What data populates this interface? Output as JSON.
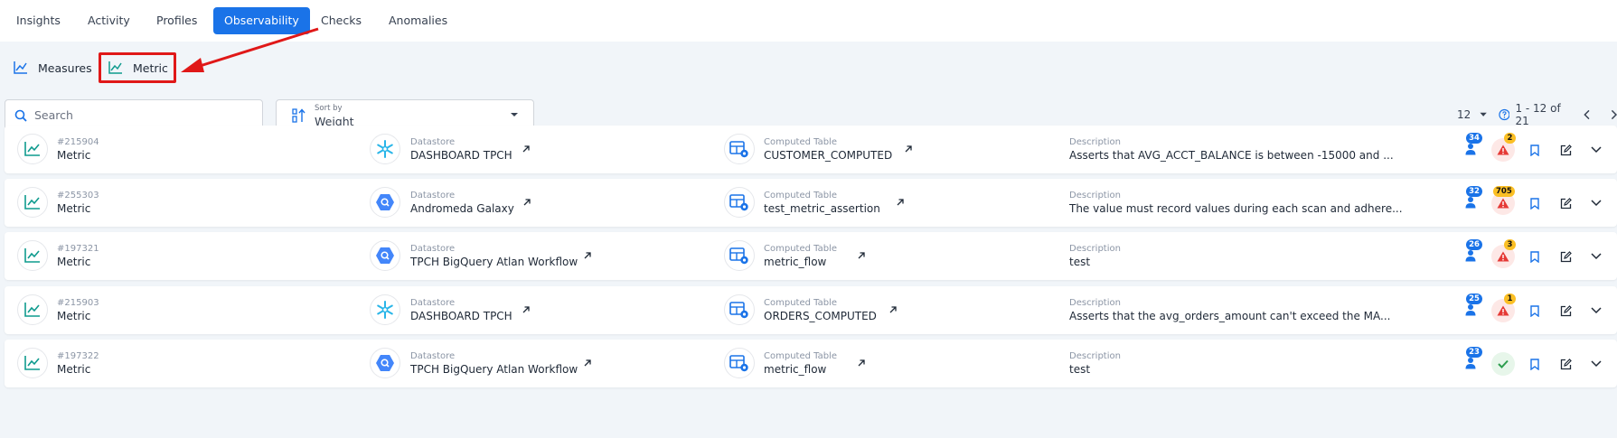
{
  "tabs": [
    {
      "label": "Insights",
      "active": false
    },
    {
      "label": "Activity",
      "active": false
    },
    {
      "label": "Profiles",
      "active": false
    },
    {
      "label": "Observability",
      "active": true
    },
    {
      "label": "Checks",
      "active": false
    },
    {
      "label": "Anomalies",
      "active": false
    }
  ],
  "subtabs": {
    "measures": "Measures",
    "metric": "Metric"
  },
  "search": {
    "placeholder": "Search"
  },
  "sort": {
    "label": "Sort by",
    "value": "Weight"
  },
  "pager": {
    "page_size": "12",
    "range": "1 - 12 of 21"
  },
  "colors": {
    "accent": "#1a73e8",
    "highlight": "#e01818",
    "icon_teal": "#0f9b8e"
  },
  "rows": [
    {
      "id": "#215904",
      "type": "Metric",
      "datastore_label": "Datastore",
      "datastore": "DASHBOARD TPCH",
      "datastore_icon": "snowflake-icon",
      "table_label": "Computed Table",
      "table": "CUSTOMER_COMPUTED",
      "desc_label": "Description",
      "desc": "Asserts that AVG_ACCT_BALANCE is between -15000 and ...",
      "users": "34",
      "anomalies": "2",
      "status": "warning"
    },
    {
      "id": "#255303",
      "type": "Metric",
      "datastore_label": "Datastore",
      "datastore": "Andromeda Galaxy",
      "datastore_icon": "bigquery-icon",
      "table_label": "Computed Table",
      "table": "test_metric_assertion",
      "desc_label": "Description",
      "desc": "The value must record values during each scan and adhere...",
      "users": "32",
      "anomalies": "705",
      "status": "warning"
    },
    {
      "id": "#197321",
      "type": "Metric",
      "datastore_label": "Datastore",
      "datastore": "TPCH BigQuery Atlan Workflow",
      "datastore_icon": "bigquery-icon",
      "table_label": "Computed Table",
      "table": "metric_flow",
      "desc_label": "Description",
      "desc": "test",
      "users": "26",
      "anomalies": "3",
      "status": "warning"
    },
    {
      "id": "#215903",
      "type": "Metric",
      "datastore_label": "Datastore",
      "datastore": "DASHBOARD TPCH",
      "datastore_icon": "snowflake-icon",
      "table_label": "Computed Table",
      "table": "ORDERS_COMPUTED",
      "desc_label": "Description",
      "desc": "Asserts that the avg_orders_amount can't exceed the MA...",
      "users": "25",
      "anomalies": "1",
      "status": "warning"
    },
    {
      "id": "#197322",
      "type": "Metric",
      "datastore_label": "Datastore",
      "datastore": "TPCH BigQuery Atlan Workflow",
      "datastore_icon": "bigquery-icon",
      "table_label": "Computed Table",
      "table": "metric_flow",
      "desc_label": "Description",
      "desc": "test",
      "users": "23",
      "anomalies": "",
      "status": "ok"
    }
  ]
}
